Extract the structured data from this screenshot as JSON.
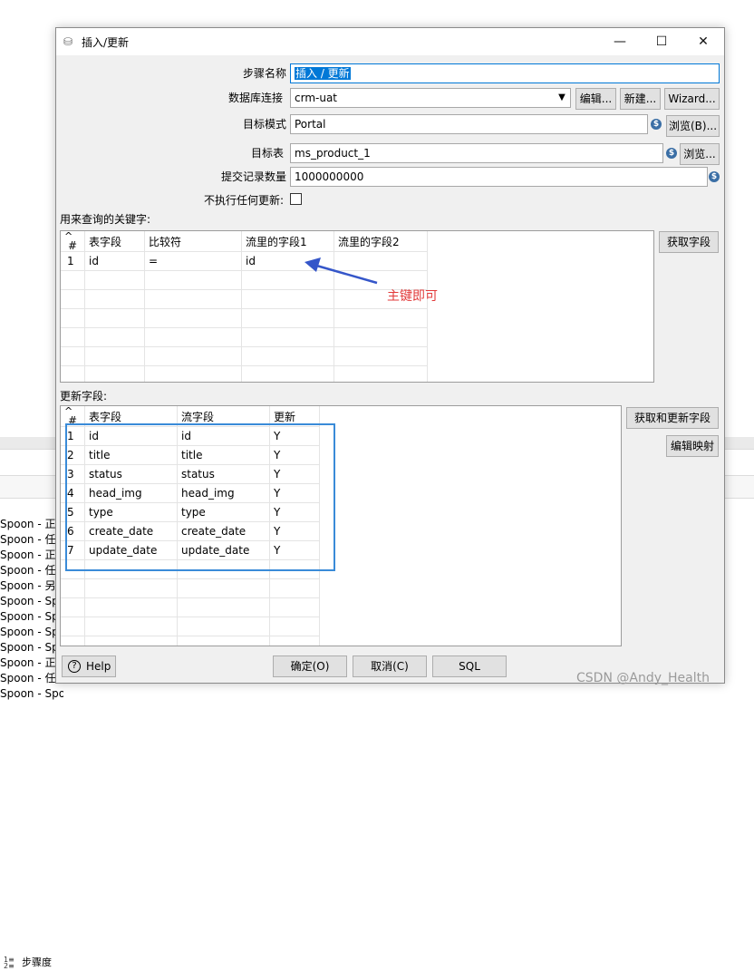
{
  "background": {
    "tab_label": "步骤度",
    "log_lines": [
      "Spoon - 正",
      "Spoon - 任",
      "Spoon - 正",
      "Spoon - 任",
      "Spoon - 另",
      "Spoon - Sp",
      "Spoon - Sp",
      "Spoon - Sp",
      "Spoon - Sp",
      "Spoon - 正",
      "Spoon - 任",
      "Spoon - Spoon"
    ]
  },
  "window": {
    "title": "插入/更新"
  },
  "form": {
    "step_name_label": "步骤名称",
    "step_name_value": "插入 / 更新",
    "db_conn_label": "数据库连接",
    "db_conn_value": "crm-uat",
    "edit_button": "编辑...",
    "new_button": "新建...",
    "wizard_button": "Wizard...",
    "schema_label": "目标模式",
    "schema_value": "Portal",
    "browse_b_button": "浏览(B)...",
    "table_label": "目标表",
    "table_value": "ms_product_1",
    "browse_button": "浏览...",
    "commit_label": "提交记录数量",
    "commit_value": "1000000000",
    "no_update_label": "不执行任何更新:",
    "var_icon": "$"
  },
  "keys": {
    "section_label": "用来查询的关键字:",
    "get_fields_button": "获取字段",
    "headers": [
      "#",
      "表字段",
      "比较符",
      "流里的字段1",
      "流里的字段2"
    ],
    "rows": [
      [
        "1",
        "id",
        "=",
        "id",
        ""
      ]
    ]
  },
  "annotation": {
    "text": "主键即可",
    "color": "#e23a3a"
  },
  "update": {
    "section_label": "更新字段:",
    "get_update_button": "获取和更新字段",
    "edit_mapping_button": "编辑映射",
    "headers": [
      "#",
      "表字段",
      "流字段",
      "更新"
    ],
    "rows": [
      [
        "1",
        "id",
        "id",
        "Y"
      ],
      [
        "2",
        "title",
        "title",
        "Y"
      ],
      [
        "3",
        "status",
        "status",
        "Y"
      ],
      [
        "4",
        "head_img",
        "head_img",
        "Y"
      ],
      [
        "5",
        "type",
        "type",
        "Y"
      ],
      [
        "6",
        "create_date",
        "create_date",
        "Y"
      ],
      [
        "7",
        "update_date",
        "update_date",
        "Y"
      ]
    ]
  },
  "footer": {
    "help_button": "Help",
    "ok_button": "确定(O)",
    "cancel_button": "取消(C)",
    "sql_button": "SQL"
  },
  "watermark": "CSDN @Andy_Health"
}
